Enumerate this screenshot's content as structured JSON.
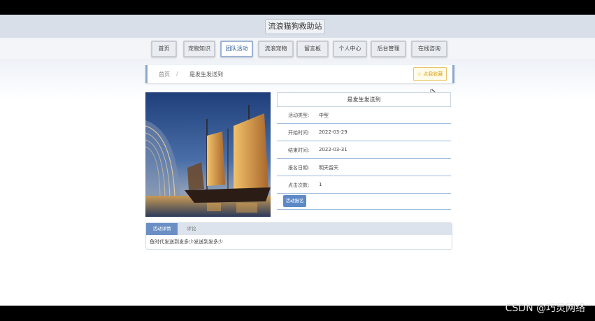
{
  "header": {
    "site_title": "流浪猫狗救助站"
  },
  "nav": {
    "items": [
      {
        "label": "首页"
      },
      {
        "label": "宠物知识"
      },
      {
        "label": "团队活动"
      },
      {
        "label": "流浪宠物"
      },
      {
        "label": "留言板"
      },
      {
        "label": "个人中心"
      },
      {
        "label": "后台管理"
      },
      {
        "label": "在线咨询"
      }
    ],
    "active": "团队活动"
  },
  "breadcrumb": {
    "home": "首页",
    "separator": "/",
    "current": "是发生发送到",
    "favorite_label": "☆ 点我收藏"
  },
  "detail": {
    "title": "是发生发送到",
    "rows": [
      {
        "label": "活动类型:",
        "value": "中型"
      },
      {
        "label": "开始时间:",
        "value": "2022-03-29"
      },
      {
        "label": "结束时间:",
        "value": "2022-03-31"
      },
      {
        "label": "报名日期:",
        "value": "明天留天"
      },
      {
        "label": "点击次数:",
        "value": "1"
      }
    ],
    "signup_label": "活动报名"
  },
  "tabs": {
    "items": [
      {
        "label": "活动详情"
      },
      {
        "label": "评论"
      }
    ],
    "content": "鱼时代发送到发多少发送到发多少"
  },
  "watermark": "CSDN @巧灵网络",
  "colors": {
    "accent": "#5d89c7",
    "border_blue": "#9fbde0",
    "favorite": "#d9a21c"
  }
}
